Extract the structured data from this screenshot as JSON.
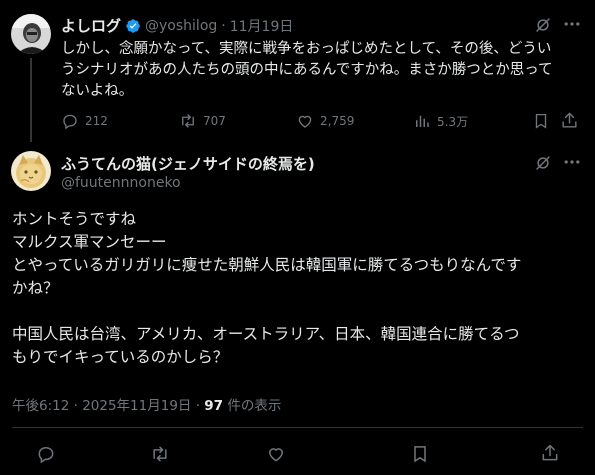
{
  "parent_tweet": {
    "display_name": "よしログ",
    "handle": "@yoshilog",
    "separator": "·",
    "date": "11月19日",
    "text_lines": [
      "しかし、念願かなって、実際に戦争をおっぱじめたとして、その後、どうい",
      "うシナリオがあの人たちの頭の中にあるんですかね。まさか勝つとか思って",
      "ないよね。"
    ],
    "replies": "212",
    "reposts": "707",
    "likes": "2,759",
    "views": "5.3万"
  },
  "main_tweet": {
    "display_name": "ふうてんの猫(ジェノサイドの終焉を)",
    "handle": "@fuutennnoneko",
    "text_lines": [
      "ホントそうですね",
      "マルクス軍マンセーー",
      "とやっているガリガリに痩せた朝鮮人民は韓国軍に勝てるつもりなんです",
      "かね？",
      "",
      "中国人民は台湾、アメリカ、オーストラリア、日本、韓国連合に勝てるつ",
      "もりでイキっているのかしら？"
    ],
    "timestamp": "午後6:12 · 2025年11月19日 · ",
    "view_count": "97",
    "view_suffix": " 件の表示"
  },
  "colors": {
    "background": "#000000",
    "text": "#e7e9ea",
    "muted": "#71767b",
    "verified": "#1d9bf0",
    "divider": "#2f3336"
  }
}
